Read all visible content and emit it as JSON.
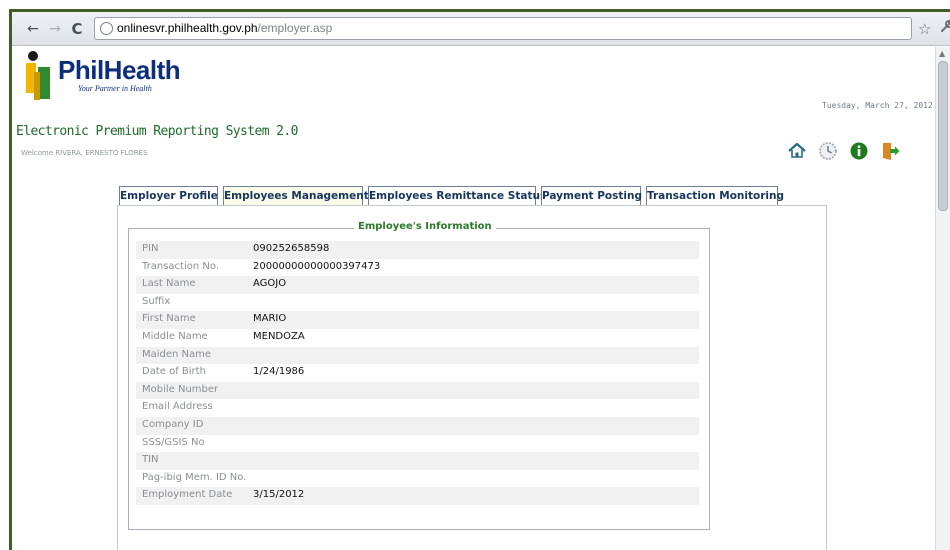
{
  "browser": {
    "url_host": "onlinesvr.philhealth.gov.ph",
    "url_path": "/employer.asp",
    "back_glyph": "←",
    "forward_glyph": "→",
    "reload_glyph": "C",
    "star_glyph": "☆",
    "wrench_glyph": "🔧"
  },
  "header": {
    "logo_text": "PhilHealth",
    "logo_tagline": "Your Partner in Health",
    "date": "Tuesday, March 27, 2012",
    "system_title": "Electronic Premium Reporting System 2.0",
    "welcome": "Welcome RIVERA, ERNESTO FLORES",
    "icons": [
      "home-icon",
      "clock-icon",
      "info-icon",
      "logout-icon"
    ]
  },
  "tabs": [
    {
      "label": "Employer Profile",
      "active": false
    },
    {
      "label": "Employees Management",
      "active": true
    },
    {
      "label": "Employees Remittance Status",
      "active": false
    },
    {
      "label": "Payment Posting",
      "active": false
    },
    {
      "label": "Transaction Monitoring",
      "active": false
    }
  ],
  "employee_info": {
    "legend": "Employee's Information",
    "rows": [
      {
        "label": "PIN",
        "value": "090252658598"
      },
      {
        "label": "Transaction No.",
        "value": "20000000000000397473"
      },
      {
        "label": "Last Name",
        "value": "AGOJO"
      },
      {
        "label": "Suffix",
        "value": ""
      },
      {
        "label": "First Name",
        "value": "MARIO"
      },
      {
        "label": "Middle Name",
        "value": "MENDOZA"
      },
      {
        "label": "Maiden Name",
        "value": ""
      },
      {
        "label": "Date of Birth",
        "value": "1/24/1986"
      },
      {
        "label": "Mobile Number",
        "value": ""
      },
      {
        "label": "Email Address",
        "value": ""
      },
      {
        "label": "Company ID",
        "value": ""
      },
      {
        "label": "SSS/GSIS No",
        "value": ""
      },
      {
        "label": "TIN",
        "value": ""
      },
      {
        "label": "Pag-ibig Mem. ID No.",
        "value": ""
      },
      {
        "label": "Employment Date",
        "value": "3/15/2012"
      }
    ]
  },
  "colors": {
    "brand_blue": "#0d2e7a",
    "title_green": "#1f6b2a",
    "legend_green": "#2c7a2c",
    "tab_text": "#17365d",
    "row_stripe": "#f1f1f1"
  }
}
